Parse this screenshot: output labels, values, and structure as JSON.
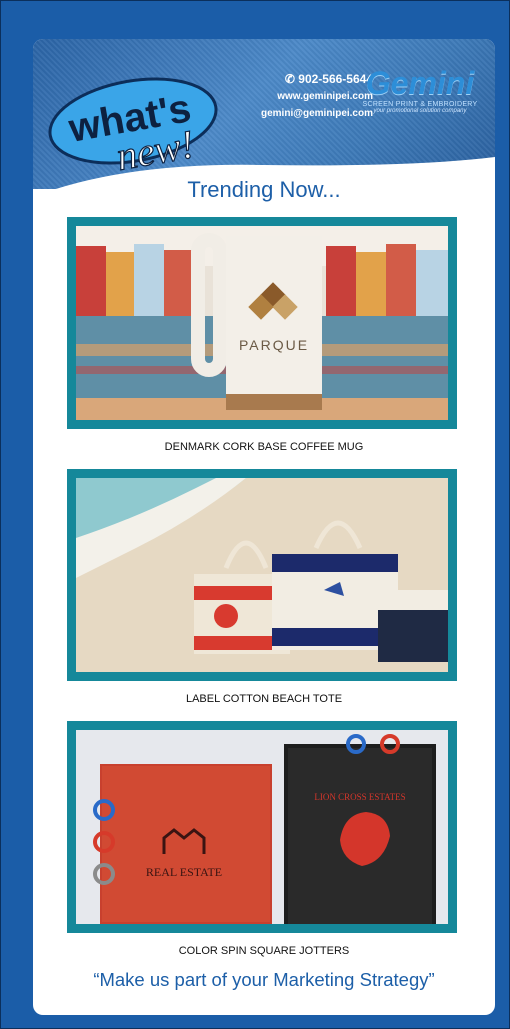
{
  "header": {
    "bubble_line1": "what's",
    "bubble_line2": "new!",
    "phone": "902-566-5644",
    "website": "www.geminipei.com",
    "email": "gemini@geminipei.com",
    "logo_name": "Gemini",
    "logo_sub": "SCREEN PRINT & EMBROIDERY",
    "logo_tagline": "your promotional solution company",
    "phone_icon": "phone-icon"
  },
  "section_title": "Trending Now...",
  "products": [
    {
      "caption": "DENMARK CORK BASE COFFEE MUG",
      "mug_text": "PARQUE"
    },
    {
      "caption": "LABEL COTTON BEACH TOTE"
    },
    {
      "caption": "COLOR SPIN SQUARE JOTTERS",
      "jotter1_text": "REAL ESTATE",
      "jotter2_text": "LION CROSS ESTATES"
    }
  ],
  "tagline": "“Make us part of your Marketing Strategy”",
  "colors": {
    "brand_blue": "#1d5fa8",
    "frame_teal": "#15889a",
    "background": "#1b5da8"
  }
}
